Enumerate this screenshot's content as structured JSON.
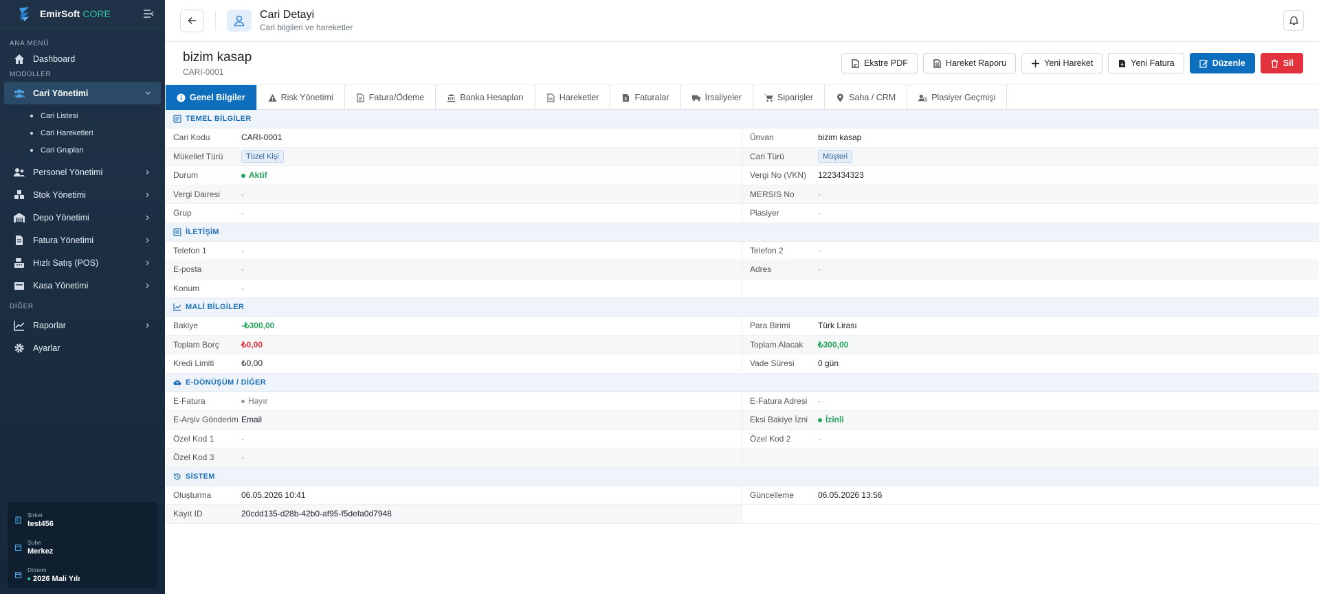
{
  "brand": {
    "name1": "EmirSoft",
    "name2": "CORE"
  },
  "sidebar": {
    "sec_main": "ANA MENÜ",
    "dashboard": "Dashboard",
    "sec_modules": "MODÜLLER",
    "cari": "Cari Yönetimi",
    "sub": [
      "Cari Listesi",
      "Cari Hareketleri",
      "Cari Grupları"
    ],
    "items": [
      "Personel Yönetimi",
      "Stok Yönetimi",
      "Depo Yönetimi",
      "Fatura Yönetimi",
      "Hızlı Satış (POS)",
      "Kasa Yönetimi"
    ],
    "sec_other": "DİĞER",
    "reports": "Raporlar",
    "settings": "Ayarlar",
    "info": {
      "company_label": "Şirket",
      "company": "test456",
      "branch_label": "Şube",
      "branch": "Merkez",
      "period_label": "Dönem",
      "period": "2026 Mali Yılı"
    }
  },
  "topbar": {
    "title": "Cari Detayi",
    "subtitle": "Cari bilgileri ve hareketler"
  },
  "header": {
    "name": "bizim kasap",
    "code": "CARI-0001"
  },
  "actions": {
    "pdf": "Ekstre PDF",
    "report": "Hareket Raporu",
    "new_move": "Yeni Hareket",
    "new_invoice": "Yeni Fatura",
    "edit": "Düzenle",
    "delete": "Sil"
  },
  "tabs": [
    "Genel Bilgiler",
    "Risk Yönetimi",
    "Fatura/Ödeme",
    "Banka Hesapları",
    "Hareketler",
    "Faturalar",
    "İrsaliyeler",
    "Siparişler",
    "Saha / CRM",
    "Plasiyer Geçmişi"
  ],
  "sections": {
    "basic": "TEMEL BİLGİLER",
    "contact": "İLETİŞİM",
    "finance": "MALİ BİLGİLER",
    "edoc": "E-DÖNÜŞÜM / DİĞER",
    "system": "SİSTEM"
  },
  "basic": {
    "cari_kodu_l": "Cari Kodu",
    "cari_kodu": "CARI-0001",
    "unvan_l": "Ünvan",
    "unvan": "bizim kasap",
    "mukellef_l": "Mükellef Türü",
    "mukellef": "Tüzel Kişi",
    "cari_turu_l": "Cari Türü",
    "cari_turu": "Müşteri",
    "durum_l": "Durum",
    "durum": "Aktif",
    "vergi_no_l": "Vergi No (VKN)",
    "vergi_no": "1223434323",
    "vergi_dairesi_l": "Vergi Dairesi",
    "vergi_dairesi": "-",
    "mersis_l": "MERSIS No",
    "mersis": "-",
    "grup_l": "Grup",
    "grup": "-",
    "plasiyer_l": "Plasiyer",
    "plasiyer": "-"
  },
  "contact": {
    "tel1_l": "Telefon 1",
    "tel1": "-",
    "tel2_l": "Telefon 2",
    "tel2": "-",
    "email_l": "E-posta",
    "email": "-",
    "adres_l": "Adres",
    "adres": "-",
    "konum_l": "Konum",
    "konum": "-"
  },
  "finance": {
    "bakiye_l": "Bakiye",
    "bakiye": "-₺300,00",
    "para_l": "Para Birimi",
    "para": "Türk Lirası",
    "borc_l": "Toplam Borç",
    "borc": "₺0,00",
    "alacak_l": "Toplam Alacak",
    "alacak": "₺300,00",
    "kredi_l": "Kredi Limiti",
    "kredi": "₺0,00",
    "vade_l": "Vade Süresi",
    "vade": "0 gün"
  },
  "edoc": {
    "efatura_l": "E-Fatura",
    "efatura": "Hayır",
    "efatura_adres_l": "E-Fatura Adresi",
    "efatura_adres": "-",
    "earsiv_l": "E-Arşiv Gönderim",
    "earsiv": "Email",
    "eksi_l": "Eksi Bakiye İzni",
    "eksi": "İzinli",
    "ozel1_l": "Özel Kod 1",
    "ozel1": "-",
    "ozel2_l": "Özel Kod 2",
    "ozel2": "-",
    "ozel3_l": "Özel Kod 3",
    "ozel3": "-"
  },
  "system": {
    "olusturma_l": "Oluşturma",
    "olusturma": "06.05.2026 10:41",
    "guncelleme_l": "Güncelleme",
    "guncelleme": "06.05.2026 13:56",
    "kayit_l": "Kayıt ID",
    "kayit": "20cdd135-d28b-42b0-af95-f5defa0d7948"
  }
}
